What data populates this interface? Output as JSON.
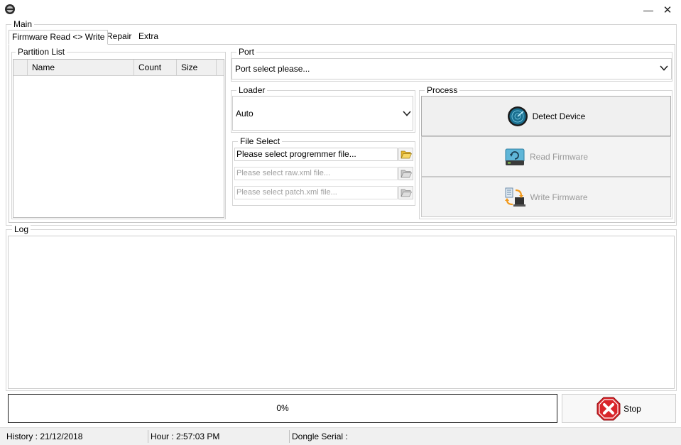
{
  "window": {
    "logo_icon": "app-logo-icon",
    "minimize_icon": "minimize-icon",
    "close_icon": "close-icon",
    "minimize_glyph": "—",
    "close_glyph": "✕"
  },
  "main": {
    "legend": "Main",
    "tabs": [
      {
        "label": "Firmware Read <> Write",
        "active": true
      },
      {
        "label": "Repair",
        "active": false
      },
      {
        "label": "Extra",
        "active": false
      }
    ]
  },
  "partition_list": {
    "legend": "Partition List",
    "columns": [
      "",
      "Name",
      "Count",
      "Size"
    ],
    "rows": []
  },
  "port": {
    "legend": "Port",
    "selected": "Port select please..."
  },
  "loader": {
    "legend": "Loader",
    "selected": "Auto"
  },
  "file_select": {
    "legend": "File Select",
    "programmer_placeholder": "Please select progremmer file...",
    "raw_placeholder": "Please select raw.xml file...",
    "patch_placeholder": "Please select patch.xml file..."
  },
  "process": {
    "legend": "Process",
    "detect_label": "Detect Device",
    "read_label": "Read Firmware",
    "write_label": "Write Firmware"
  },
  "log": {
    "legend": "Log",
    "content": ""
  },
  "progress": {
    "value": 0,
    "text": "0%"
  },
  "stop": {
    "label": "Stop"
  },
  "statusbar": {
    "history": "History : 21/12/2018",
    "hour": "Hour  : 2:57:03 PM",
    "dongle": "Dongle Serial :"
  },
  "colors": {
    "progress_fill": "#06b025",
    "stop_red": "#d9262b",
    "detect_ring": "#1a6f8f"
  }
}
